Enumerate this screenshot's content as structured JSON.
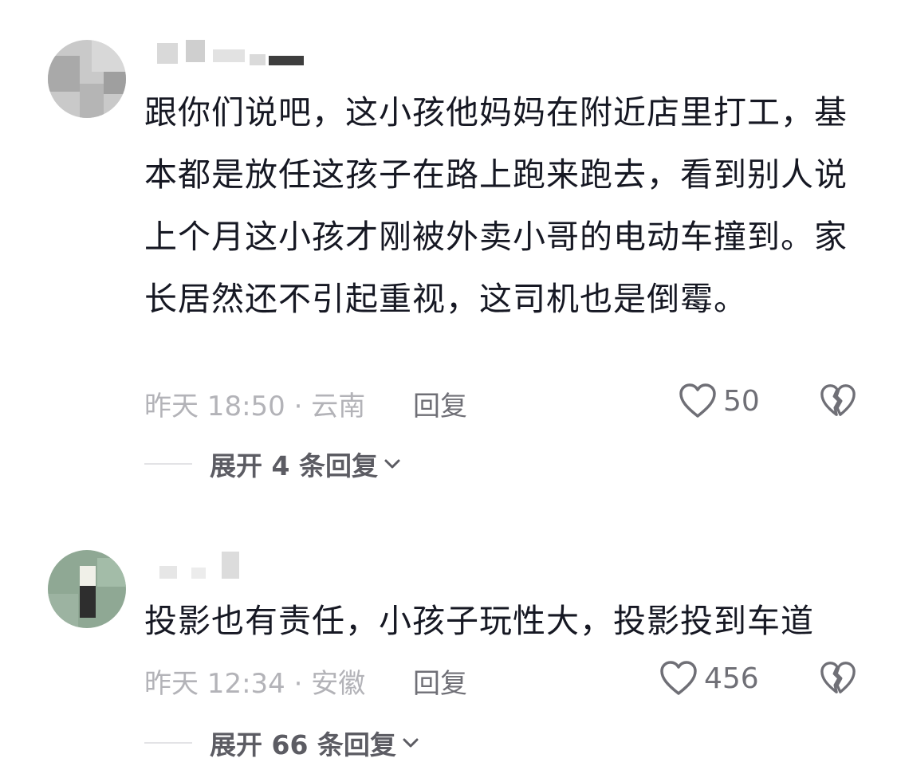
{
  "comments": [
    {
      "text": "跟你们说吧，这小孩他妈妈在附近店里打工，基本都是放任这孩子在路上跑来跑去，看到别人说上个月这小孩才刚被外卖小哥的电动车撞到。家长居然还不引起重视，这司机也是倒霉。",
      "meta": "昨天 18:50 · 云南",
      "reply_label": "回复",
      "like_count": "50",
      "expand_label": "展开 4 条回复",
      "like_icon": "heart-outline-icon",
      "dislike_icon": "broken-heart-icon"
    },
    {
      "text": "投影也有责任，小孩子玩性大，投影投到车道",
      "meta": "昨天 12:34 · 安徽",
      "reply_label": "回复",
      "like_count": "456",
      "expand_label": "展开 66 条回复",
      "like_icon": "heart-outline-icon",
      "dislike_icon": "broken-heart-icon"
    }
  ],
  "colors": {
    "text": "#161823",
    "meta": "#b3b3b8",
    "action": "#6f6f76",
    "expand": "#5c5c63",
    "divider": "#e3e3e6"
  }
}
